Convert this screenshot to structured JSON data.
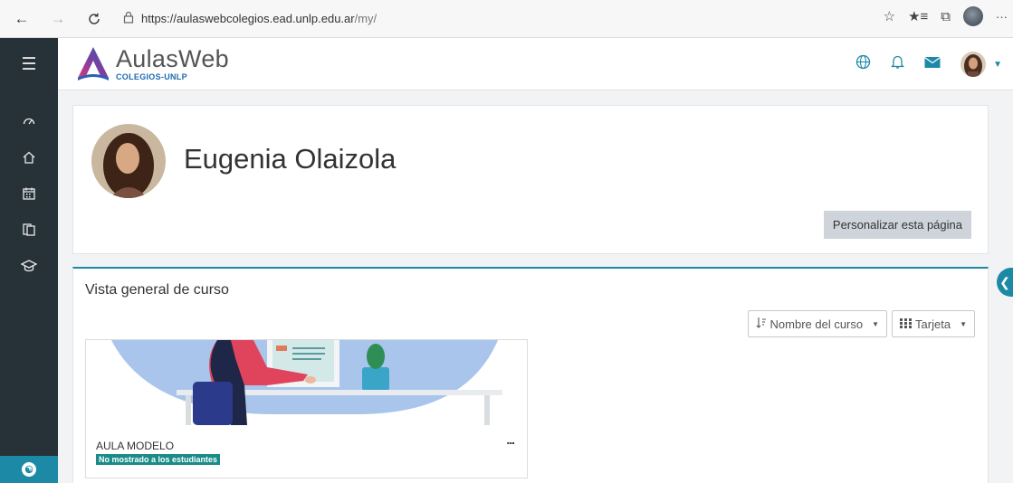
{
  "browser": {
    "url_host": "https://aulaswebcolegios.ead.unlp.edu.ar",
    "url_path": "/my/",
    "icons": [
      "back-icon",
      "forward-icon",
      "refresh-icon",
      "lock-icon",
      "favorite-star-icon",
      "favorites-list-icon",
      "collections-icon",
      "profile-icon",
      "more-icon"
    ]
  },
  "brand": {
    "title": "AulasWeb",
    "subtitle": "COLEGIOS-UNLP",
    "accent": "#1c8aa6"
  },
  "sidebar": {
    "items": [
      "dashboard-icon",
      "home-icon",
      "calendar-icon",
      "files-icon",
      "courses-icon"
    ],
    "accessibility": "accessibility-icon"
  },
  "header": {
    "user_name": "Eugenia Olaizola",
    "customize_label": "Personalizar esta página"
  },
  "overview": {
    "title": "Vista general de curso",
    "sort_label": "Nombre del curso",
    "view_label": "Tarjeta"
  },
  "course": {
    "name": "AULA MODELO",
    "badge": "No mostrado a los estudiantes",
    "menu": "..."
  }
}
